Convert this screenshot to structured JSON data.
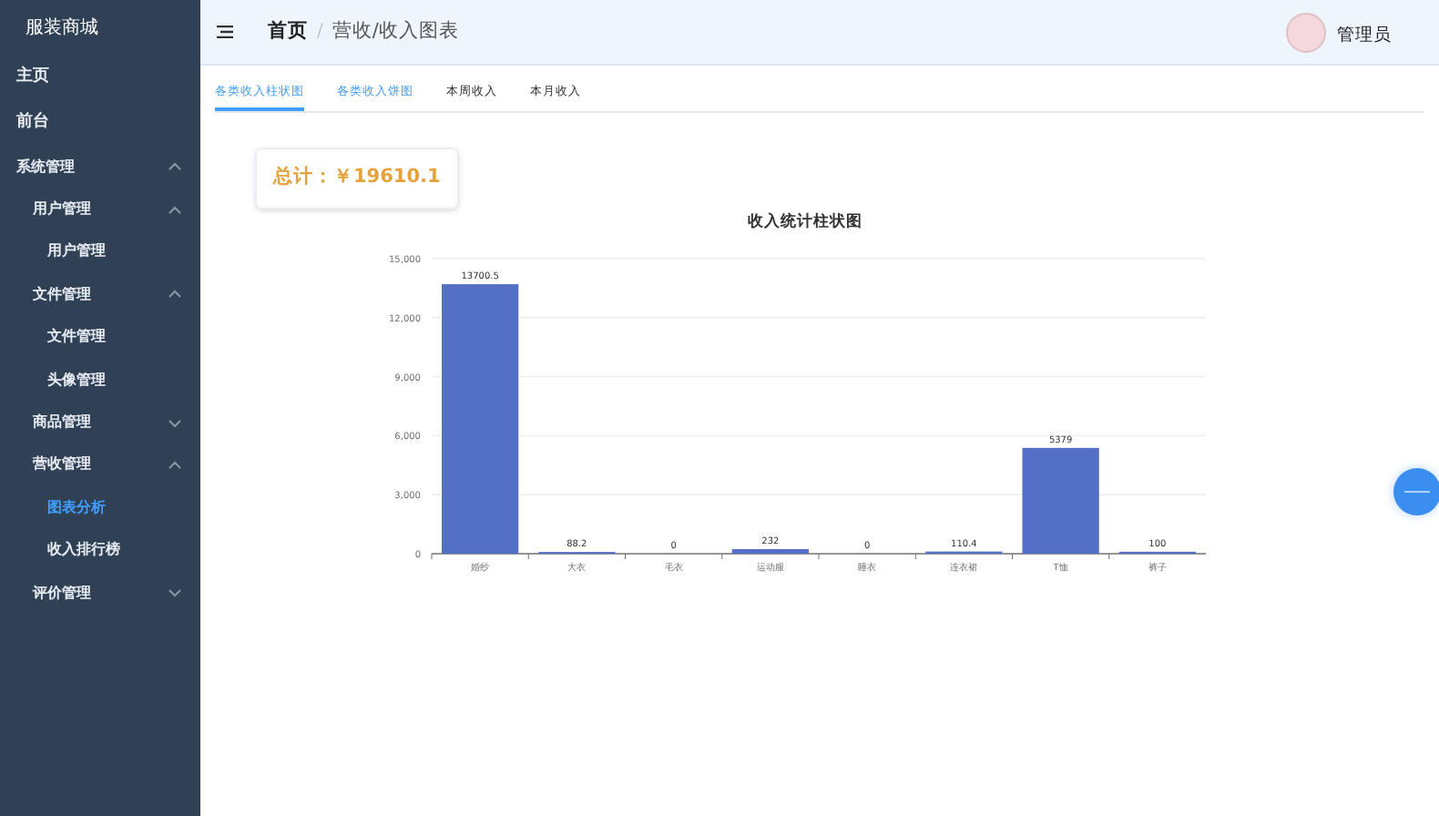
{
  "sidebar": {
    "title": "服装商城",
    "items": [
      {
        "label": "主页",
        "selected": false
      },
      {
        "label": "前台",
        "selected": false
      },
      {
        "label": "系统管理",
        "expanded": true,
        "selected": false,
        "children": [
          {
            "label": "用户管理",
            "expanded": true,
            "selected": false,
            "children": [
              {
                "label": "用户管理",
                "selected": false
              }
            ]
          },
          {
            "label": "文件管理",
            "expanded": true,
            "selected": false,
            "children": [
              {
                "label": "文件管理",
                "selected": false
              },
              {
                "label": "头像管理",
                "selected": false
              }
            ]
          },
          {
            "label": "商品管理",
            "expanded": false,
            "selected": false
          },
          {
            "label": "营收管理",
            "expanded": true,
            "selected": false,
            "children": [
              {
                "label": "图表分析",
                "selected": true
              },
              {
                "label": "收入排行榜",
                "selected": false
              }
            ]
          },
          {
            "label": "评价管理",
            "expanded": false,
            "selected": false
          }
        ]
      }
    ]
  },
  "header": {
    "breadcrumb": [
      "首页",
      "营收/收入图表"
    ],
    "separator": "/",
    "user": "管理员"
  },
  "tabs": [
    {
      "label": "各类收入柱状图",
      "selected": true
    },
    {
      "label": "各类收入饼图",
      "selected": false
    },
    {
      "label": "本周收入",
      "selected": false
    },
    {
      "label": "本月收入",
      "selected": false
    }
  ],
  "total": "总计：￥19610.1",
  "chart_data": {
    "type": "bar",
    "title": "收入统计柱状图",
    "categories": [
      "婚纱",
      "大衣",
      "毛衣",
      "运动服",
      "睡衣",
      "连衣裙",
      "T恤",
      "裤子"
    ],
    "series": [
      {
        "color": "#5470c6",
        "values": [
          13700.5,
          88.2,
          0,
          232,
          0,
          110.4,
          5379,
          100
        ]
      }
    ],
    "ylim": [
      0,
      15000
    ],
    "yticks": [
      {
        "value": 0,
        "label": "0"
      },
      {
        "value": 3000,
        "label": "3,000"
      },
      {
        "value": 6000,
        "label": "6,000"
      },
      {
        "value": 9000,
        "label": "9,000"
      },
      {
        "value": 12000,
        "label": "12,000"
      },
      {
        "value": 15000,
        "label": "15,000"
      }
    ],
    "grid": true,
    "data_labels": true,
    "value_labels": [
      "13700.5",
      "88.2",
      "0",
      "232",
      "0",
      "110.4",
      "5379",
      "100"
    ]
  }
}
